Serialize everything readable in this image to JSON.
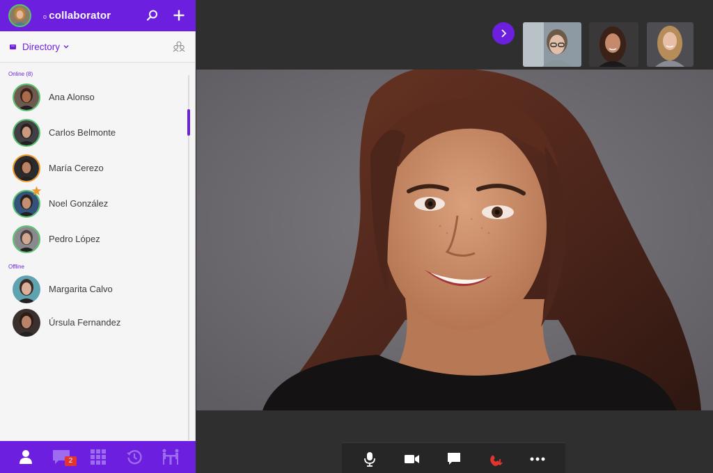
{
  "app": {
    "brand": "collaborator",
    "brand_mark": "o"
  },
  "topbar": {
    "search_icon": "search-icon",
    "add_icon": "plus-icon"
  },
  "directory": {
    "label": "Directory",
    "groups_icon": "groups-icon"
  },
  "sections": {
    "online_label": "Online (8)",
    "offline_label": "Offline"
  },
  "contacts_online": [
    {
      "name": "Ana Alonso",
      "status": "online",
      "skin": "#a86b4c",
      "hair": "#3b2218",
      "bg": "#6b5a4d"
    },
    {
      "name": "Carlos Belmonte",
      "status": "online",
      "skin": "#c99a80",
      "hair": "#2a211e",
      "bg": "#3f3f44"
    },
    {
      "name": "María Cerezo",
      "status": "busy",
      "skin": "#b98367",
      "hair": "#2e1d17",
      "bg": "#2b2b2e"
    },
    {
      "name": "Noel González",
      "status": "online",
      "skin": "#c28f73",
      "hair": "#2b211c",
      "bg": "#34527a",
      "favorite": true
    },
    {
      "name": "Pedro López",
      "status": "online",
      "skin": "#d1a891",
      "hair": "#4a4040",
      "bg": "#8a8a8e"
    }
  ],
  "contacts_offline": [
    {
      "name": "Margarita Calvo",
      "status": "offline",
      "skin": "#d9b09a",
      "hair": "#3d2a22",
      "bg": "#5fa3b0"
    },
    {
      "name": "Úrsula Fernandez",
      "status": "offline",
      "skin": "#b88469",
      "hair": "#2d1c16",
      "bg": "#3a302d"
    }
  ],
  "bottom_nav": {
    "chat_badge": "2"
  },
  "colors": {
    "accent": "#6d1fe0",
    "online": "#54c36b",
    "busy": "#f0962a",
    "hangup": "#e3342f"
  }
}
